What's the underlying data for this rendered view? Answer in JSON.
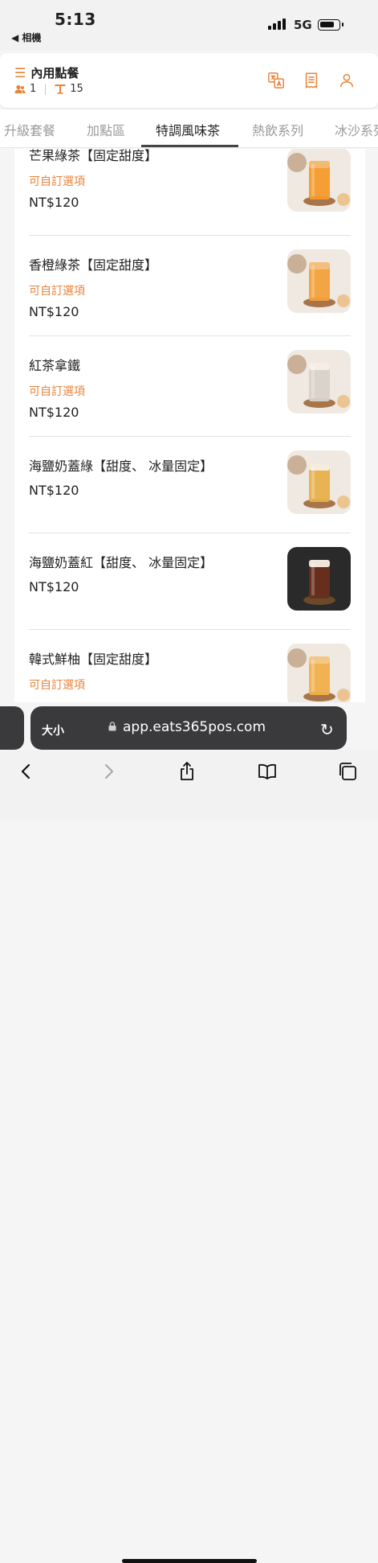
{
  "status_bar": {
    "time": "5:13",
    "back_app": "◀ 相機",
    "network": "5G"
  },
  "header": {
    "title": "內用點餐",
    "guests": "1",
    "table": "15",
    "icons": [
      "translate-icon",
      "receipt-icon",
      "user-icon"
    ]
  },
  "tabs": [
    {
      "label": "升級套餐",
      "active": false
    },
    {
      "label": "加點區",
      "active": false
    },
    {
      "label": "特調風味茶",
      "active": true
    },
    {
      "label": "熱飲系列",
      "active": false
    },
    {
      "label": "冰沙系列",
      "active": false
    }
  ],
  "items": [
    {
      "name": "芒果綠茶【固定甜度】",
      "option": "可自訂選項",
      "price": "NT$120"
    },
    {
      "name": "香橙綠茶【固定甜度】",
      "option": "可自訂選項",
      "price": "NT$120"
    },
    {
      "name": "紅茶拿鐵",
      "option": "可自訂選項",
      "price": "NT$120"
    },
    {
      "name": "海鹽奶蓋綠【甜度、 冰量固定】",
      "option": "",
      "price": "NT$120"
    },
    {
      "name": "海鹽奶蓋紅【甜度、 冰量固定】",
      "option": "",
      "price": "NT$120"
    },
    {
      "name": "韓式鮮柚【固定甜度】",
      "option": "可自訂選項",
      "price": ""
    }
  ],
  "browser": {
    "text_size_label": "大小",
    "url": "app.eats365pos.com",
    "toolbar_icons": [
      "back-icon",
      "forward-icon",
      "share-icon",
      "bookmarks-icon",
      "tabs-icon"
    ]
  },
  "colors": {
    "accent": "#e8833a",
    "drink_colors": [
      "#f39a2a",
      "#f2a13a",
      "#d8d2c8",
      "#e7b04a",
      "#6a2e1e",
      "#f0b04a"
    ]
  }
}
